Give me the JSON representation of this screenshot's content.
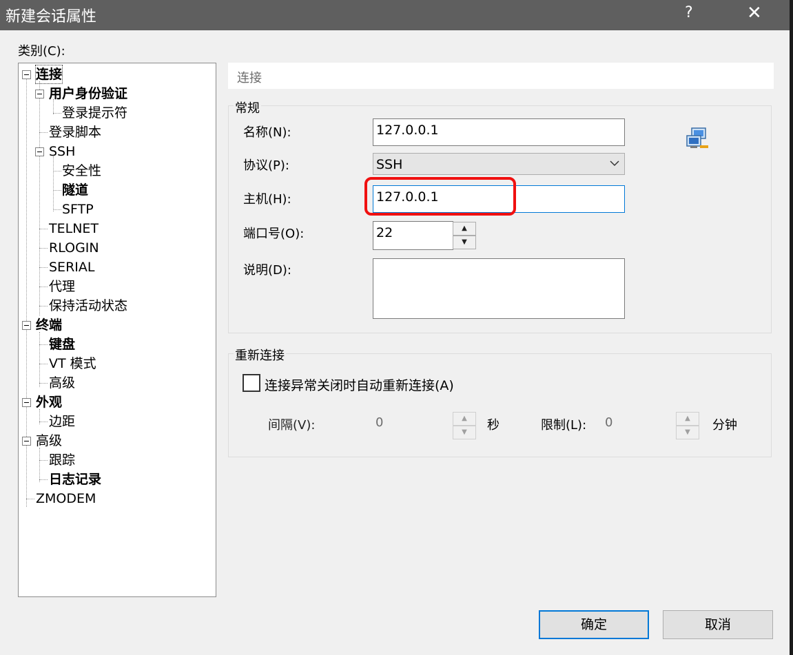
{
  "window": {
    "title": "新建会话属性",
    "help_label": "?",
    "close_label": "✕"
  },
  "category": {
    "label": "类别(C):",
    "items": [
      {
        "label": "连接",
        "bold": true
      },
      {
        "label": "用户身份验证",
        "bold": true
      },
      {
        "label": "登录提示符",
        "bold": false
      },
      {
        "label": "登录脚本",
        "bold": false
      },
      {
        "label": "SSH",
        "bold": false
      },
      {
        "label": "安全性",
        "bold": false
      },
      {
        "label": "隧道",
        "bold": true
      },
      {
        "label": "SFTP",
        "bold": false
      },
      {
        "label": "TELNET",
        "bold": false
      },
      {
        "label": "RLOGIN",
        "bold": false
      },
      {
        "label": "SERIAL",
        "bold": false
      },
      {
        "label": "代理",
        "bold": false
      },
      {
        "label": "保持活动状态",
        "bold": false
      },
      {
        "label": "终端",
        "bold": true
      },
      {
        "label": "键盘",
        "bold": true
      },
      {
        "label": "VT 模式",
        "bold": false
      },
      {
        "label": "高级",
        "bold": false
      },
      {
        "label": "外观",
        "bold": true
      },
      {
        "label": "边距",
        "bold": false
      },
      {
        "label": "高级",
        "bold": false
      },
      {
        "label": "跟踪",
        "bold": false
      },
      {
        "label": "日志记录",
        "bold": true
      },
      {
        "label": "ZMODEM",
        "bold": false
      }
    ]
  },
  "panel": {
    "header": "连接",
    "general": {
      "title": "常规",
      "name_label": "名称(N):",
      "name_value": "127.0.0.1",
      "protocol_label": "协议(P):",
      "protocol_value": "SSH",
      "host_label": "主机(H):",
      "host_value": "127.0.0.1",
      "port_label": "端口号(O):",
      "port_value": "22",
      "desc_label": "说明(D):",
      "desc_value": ""
    },
    "reconnect": {
      "title": "重新连接",
      "checkbox_label": "连接异常关闭时自动重新连接(A)",
      "checked": false,
      "interval_label": "间隔(V):",
      "interval_value": "0",
      "interval_unit": "秒",
      "limit_label": "限制(L):",
      "limit_value": "0",
      "limit_unit": "分钟"
    }
  },
  "buttons": {
    "ok": "确定",
    "cancel": "取消"
  },
  "colors": {
    "titlebar": "#5f5f5f",
    "highlight": "#f01010",
    "focus": "#0078d7"
  },
  "icons": {
    "network": "network-computers-icon",
    "chevron": "chevron-down-icon"
  }
}
